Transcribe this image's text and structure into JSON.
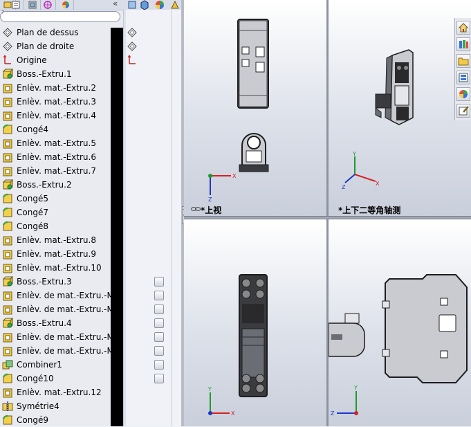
{
  "tree": {
    "search_placeholder": "",
    "items": [
      {
        "label": "Plan de dessus",
        "icon": "plane-icon"
      },
      {
        "label": "Plan de droite",
        "icon": "plane-icon"
      },
      {
        "label": "Origine",
        "icon": "origin-icon"
      },
      {
        "label": "Boss.-Extru.1",
        "icon": "boss-extrude-icon"
      },
      {
        "label": "Enlèv. mat.-Extru.2",
        "icon": "cut-extrude-icon"
      },
      {
        "label": "Enlèv. mat.-Extru.3",
        "icon": "cut-extrude-icon"
      },
      {
        "label": "Enlèv. mat.-Extru.4",
        "icon": "cut-extrude-icon"
      },
      {
        "label": "Congé4",
        "icon": "fillet-icon"
      },
      {
        "label": "Enlèv. mat.-Extru.5",
        "icon": "cut-extrude-icon"
      },
      {
        "label": "Enlèv. mat.-Extru.6",
        "icon": "cut-extrude-icon"
      },
      {
        "label": "Enlèv. mat.-Extru.7",
        "icon": "cut-extrude-icon"
      },
      {
        "label": "Boss.-Extru.2",
        "icon": "boss-extrude-icon"
      },
      {
        "label": "Congé5",
        "icon": "fillet-icon"
      },
      {
        "label": "Congé7",
        "icon": "fillet-icon"
      },
      {
        "label": "Congé8",
        "icon": "fillet-icon"
      },
      {
        "label": "Enlèv. mat.-Extru.8",
        "icon": "cut-extrude-icon"
      },
      {
        "label": "Enlèv. mat.-Extru.9",
        "icon": "cut-extrude-icon"
      },
      {
        "label": "Enlèv. mat.-Extru.10",
        "icon": "cut-extrude-icon"
      },
      {
        "label": "Boss.-Extru.3",
        "icon": "boss-extrude-icon"
      },
      {
        "label": "Enlèv. de mat.-Extru.-Mince",
        "icon": "cut-extrude-icon"
      },
      {
        "label": "Enlèv. de mat.-Extru.-Mince",
        "icon": "cut-extrude-icon"
      },
      {
        "label": "Boss.-Extru.4",
        "icon": "boss-extrude-icon"
      },
      {
        "label": "Enlèv. de mat.-Extru.-Mince",
        "icon": "cut-extrude-icon"
      },
      {
        "label": "Enlèv. de mat.-Extru.-Mince",
        "icon": "cut-extrude-icon"
      },
      {
        "label": "Combiner1",
        "icon": "combine-icon"
      },
      {
        "label": "Congé10",
        "icon": "fillet-icon"
      },
      {
        "label": "Enlèv. mat.-Extru.12",
        "icon": "cut-extrude-icon"
      },
      {
        "label": "Symétrie4",
        "icon": "mirror-icon"
      },
      {
        "label": "Congé9",
        "icon": "fillet-icon"
      }
    ]
  },
  "viewports": {
    "top_left": {
      "label": "*上视"
    },
    "top_right": {
      "label": "*上下二等角轴测"
    }
  },
  "triad": {
    "x": "X",
    "y": "Y",
    "z": "Z"
  },
  "colors": {
    "axis_x": "#d62020",
    "axis_y": "#1f9a2a",
    "axis_z": "#2035c8",
    "part_dark": "#2a2a2c",
    "part_body": "#6a6d73",
    "part_light": "#c9cbd0"
  },
  "task_pane": [
    "home-icon",
    "library-icon",
    "folder-icon",
    "view-palette-icon",
    "appearance-icon",
    "custom-properties-icon"
  ]
}
